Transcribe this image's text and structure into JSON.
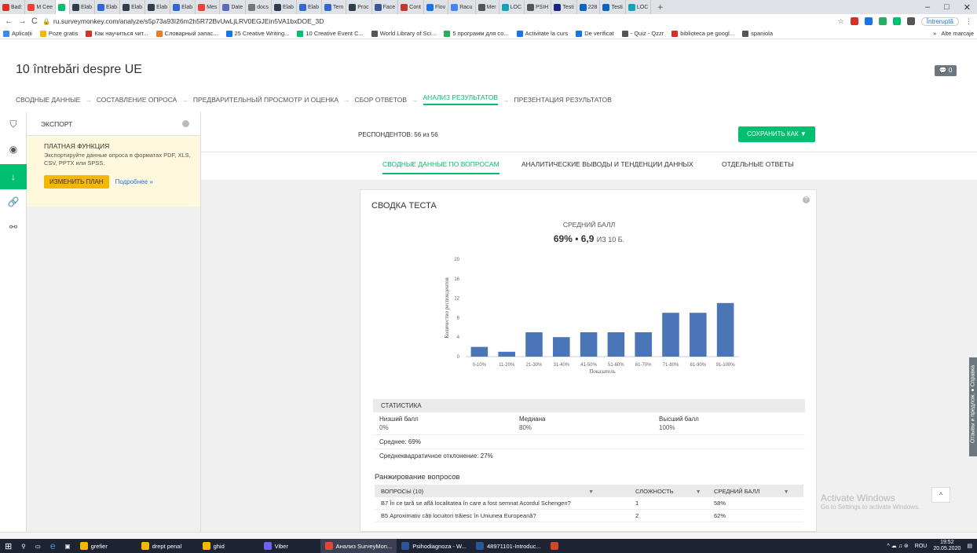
{
  "browser": {
    "tabs": [
      {
        "label": "Bad:",
        "color": "#d93025"
      },
      {
        "label": "M Cee",
        "color": "#ea4335"
      },
      {
        "label": "",
        "color": "#00bf6f",
        "active": true
      },
      {
        "label": "Elab",
        "color": "#2c3e50"
      },
      {
        "label": "Elab",
        "color": "#3367d6"
      },
      {
        "label": "Elab",
        "color": "#2c3e50"
      },
      {
        "label": "Elab",
        "color": "#2c3e50"
      },
      {
        "label": "Elab",
        "color": "#3367d6"
      },
      {
        "label": "Mes",
        "color": "#ea4335"
      },
      {
        "label": "Date",
        "color": "#5c6bc0"
      },
      {
        "label": "docs",
        "color": "#777"
      },
      {
        "label": "Elab",
        "color": "#2c3e50"
      },
      {
        "label": "Elab",
        "color": "#3367d6"
      },
      {
        "label": "Tem",
        "color": "#3367d6"
      },
      {
        "label": "Proc",
        "color": "#2c3e50"
      },
      {
        "label": "Face",
        "color": "#3b5998"
      },
      {
        "label": "Cont",
        "color": "#c0392b"
      },
      {
        "label": "Flov",
        "color": "#1a73e8"
      },
      {
        "label": "Racu",
        "color": "#4285f4"
      },
      {
        "label": "Mer",
        "color": "#555"
      },
      {
        "label": "LOC",
        "color": "#17a2b8"
      },
      {
        "label": "PSIH",
        "color": "#555"
      },
      {
        "label": "Testi",
        "color": "#1a237e"
      },
      {
        "label": "228",
        "color": "#0a66c2"
      },
      {
        "label": "Testi",
        "color": "#0a66c2"
      },
      {
        "label": "LOC",
        "color": "#17a2b8"
      }
    ],
    "new_tab": "+",
    "url": "ru.surveymonkey.com/analyze/s5p73a93I26m2h5R72BvUwLjLRV0EGJEin5VA1bxDOE_3D",
    "profile_label": "Întreruptă",
    "bookmarks": [
      {
        "label": "Aplicații",
        "color": "#4285f4"
      },
      {
        "label": "Poze gratis",
        "color": "#f6b700"
      },
      {
        "label": "Как научиться чит...",
        "color": "#d93025"
      },
      {
        "label": "Словарный запас...",
        "color": "#e67e22"
      },
      {
        "label": "25 Creative Writing...",
        "color": "#1a73e8"
      },
      {
        "label": "10 Creative Event C...",
        "color": "#00bf6f"
      },
      {
        "label": "World Library of Sci...",
        "color": "#555"
      },
      {
        "label": "5 программ для со...",
        "color": "#27ae60"
      },
      {
        "label": "Activitate la curs",
        "color": "#1a73e8"
      },
      {
        "label": "De verificat",
        "color": "#1a73e8"
      },
      {
        "label": "- Quiz - Qzzr",
        "color": "#555"
      },
      {
        "label": "biblioteca pe googl...",
        "color": "#d93025"
      },
      {
        "label": "spaniola",
        "color": "#555"
      }
    ],
    "bookmarks_more": "»",
    "other_bookmarks": "Alte marcaje"
  },
  "survey": {
    "title": "10 întrebări despre UE",
    "comment_count": "0",
    "steps": [
      "СВОДНЫЕ ДАННЫЕ",
      "СОСТАВЛЕНИЕ ОПРОСА",
      "ПРЕДВАРИТЕЛЬНЫЙ ПРОСМОТР И ОЦЕНКА",
      "СБОР ОТВЕТОВ",
      "АНАЛИЗ РЕЗУЛЬТАТОВ",
      "ПРЕЗЕНТАЦИЯ РЕЗУЛЬТАТОВ"
    ],
    "active_step": 4
  },
  "export": {
    "title": "ЭКСПОРТ",
    "paid_title": "ПЛАТНАЯ ФУНКЦИЯ",
    "paid_desc": "Экспортируйте данные опроса в форматах PDF, XLS, CSV, PPTX или SPSS.",
    "upgrade": "ИЗМЕНИТЬ ПЛАН",
    "more": "Подробнее »"
  },
  "main": {
    "respondents": "РЕСПОНДЕНТОВ: 56 из 56",
    "save_as": "СОХРАНИТЬ КАК",
    "view_tabs": [
      "СВОДНЫЕ ДАННЫЕ ПО ВОПРОСАМ",
      "АНАЛИТИЧЕСКИЕ ВЫВОДЫ И ТЕНДЕНЦИИ ДАННЫХ",
      "ОТДЕЛЬНЫЕ ОТВЕТЫ"
    ]
  },
  "card": {
    "title": "СВОДКА ТЕСТА",
    "avg_label": "СРЕДНИЙ БАЛЛ",
    "avg_value": "69% • 6,9",
    "avg_suffix": "ИЗ 10 Б.",
    "stats_header": "СТАТИСТИКА",
    "stats": [
      {
        "label": "Низший балл",
        "value": "0%"
      },
      {
        "label": "Медиана",
        "value": "80%"
      },
      {
        "label": "Высший балл",
        "value": "100%"
      }
    ],
    "mean": "Среднее: 69%",
    "stddev": "Среднеквадратичное отклонение: 27%",
    "ranking_title": "Ранжирование вопросов",
    "ranking_headers": [
      "ВОПРОСЫ (10)",
      "СЛОЖНОСТЬ",
      "СРЕДНИЙ БАЛЛ"
    ],
    "ranking_rows": [
      {
        "q": "В7  În ce țară se află localitatea în care a fost semnat Acordul Schengen?",
        "difficulty": "1",
        "avg": "58%"
      },
      {
        "q": "В5  Aproximativ câți locuitori trăiesc în Uniunea Europeană?",
        "difficulty": "2",
        "avg": "62%"
      }
    ]
  },
  "chart_data": {
    "type": "bar",
    "categories": [
      "0-10%",
      "11-20%",
      "21-30%",
      "31-40%",
      "41-50%",
      "51-60%",
      "61-70%",
      "71-80%",
      "81-90%",
      "91-100%"
    ],
    "values": [
      2,
      1,
      5,
      4,
      5,
      5,
      5,
      9,
      9,
      11
    ],
    "xlabel": "Показатель",
    "ylabel": "Количество респондентов",
    "ylim": [
      0,
      20
    ],
    "yticks": [
      0,
      4,
      8,
      12,
      16,
      20
    ],
    "bar_color": "#4a76b8",
    "grid": false
  },
  "overlay": {
    "activate_title": "Activate Windows",
    "activate_sub": "Go to Settings to activate Windows.",
    "feedback": "Отзывы и предлож. ● Справка"
  },
  "taskbar": {
    "apps": [
      {
        "label": "grefier",
        "color": "#f6b700"
      },
      {
        "label": "drept penal",
        "color": "#f6b700"
      },
      {
        "label": "ghid",
        "color": "#f6b700"
      },
      {
        "label": "Viber",
        "color": "#7360f2"
      },
      {
        "label": "Анализ SurveyMon...",
        "color": "#ea4335",
        "active": true
      },
      {
        "label": "Psihodiagnoza - W...",
        "color": "#2b579a"
      },
      {
        "label": "48971101-Introduc...",
        "color": "#2b579a"
      },
      {
        "label": "",
        "color": "#d24726"
      }
    ],
    "lang": "ROU",
    "time": "19:52",
    "date": "20.05.2020"
  }
}
